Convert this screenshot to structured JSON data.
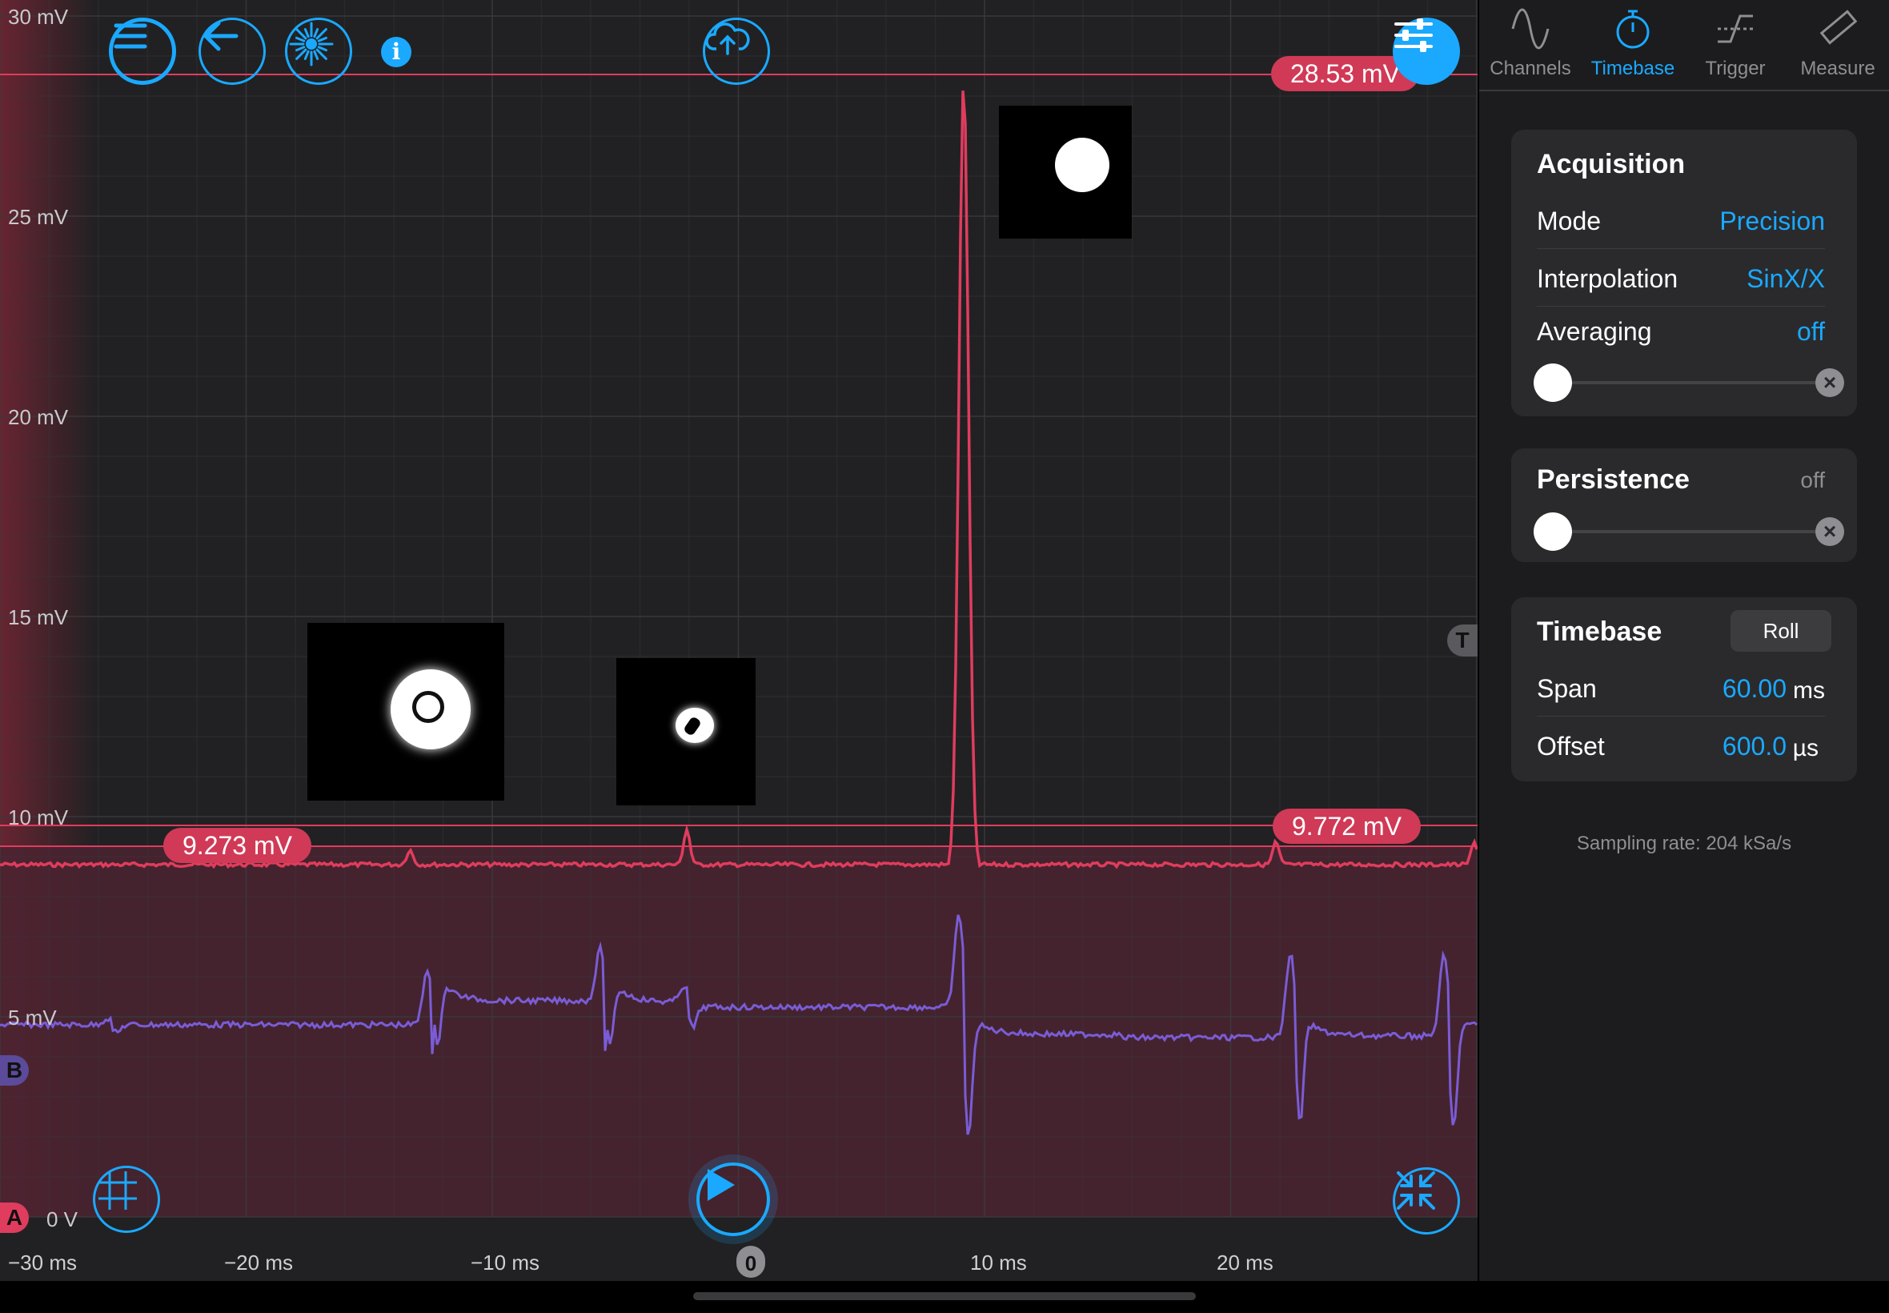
{
  "plot": {
    "y_ticks": [
      "30 mV",
      "25 mV",
      "20 mV",
      "15 mV",
      "10 mV",
      "5 mV",
      "0 V"
    ],
    "x_ticks": [
      "−30 ms",
      "−20 ms",
      "−10 ms",
      "10 ms",
      "20 ms"
    ],
    "zero_marker": "0",
    "cursor_values": {
      "top": "28.53 mV",
      "left": "9.273 mV",
      "right": "9.772 mV"
    },
    "channel_a_label": "A",
    "channel_b_label": "B",
    "trigger_marker": "T",
    "colors": {
      "channel_a": "#e03c5e",
      "channel_b": "#7a5cd6",
      "accent": "#1aa9ff"
    }
  },
  "toolbar": {
    "icons": [
      "menu-icon",
      "back-arrow-icon",
      "burst-icon",
      "info-icon",
      "cloud-upload-icon",
      "settings-sliders-icon"
    ]
  },
  "bottom_controls": {
    "icons": [
      "grid-icon",
      "play-icon",
      "shrink-icon"
    ]
  },
  "panel": {
    "tabs": [
      {
        "label": "Channels",
        "icon": "sine-wave-icon",
        "active": false
      },
      {
        "label": "Timebase",
        "icon": "stopwatch-icon",
        "active": true
      },
      {
        "label": "Trigger",
        "icon": "trigger-edge-icon",
        "active": false
      },
      {
        "label": "Measure",
        "icon": "ruler-icon",
        "active": false
      }
    ],
    "acquisition": {
      "title": "Acquisition",
      "mode_label": "Mode",
      "mode_value": "Precision",
      "interp_label": "Interpolation",
      "interp_value": "SinX/X",
      "avg_label": "Averaging",
      "avg_value": "off",
      "avg_level": 0
    },
    "persistence": {
      "title": "Persistence",
      "value": "off",
      "level": 0
    },
    "timebase": {
      "title": "Timebase",
      "roll_label": "Roll",
      "span_label": "Span",
      "span_value": "60.00",
      "span_unit": "ms",
      "offset_label": "Offset",
      "offset_value": "600.0",
      "offset_unit": "µs"
    },
    "sampling_rate": "Sampling rate: 204 kSa/s"
  }
}
